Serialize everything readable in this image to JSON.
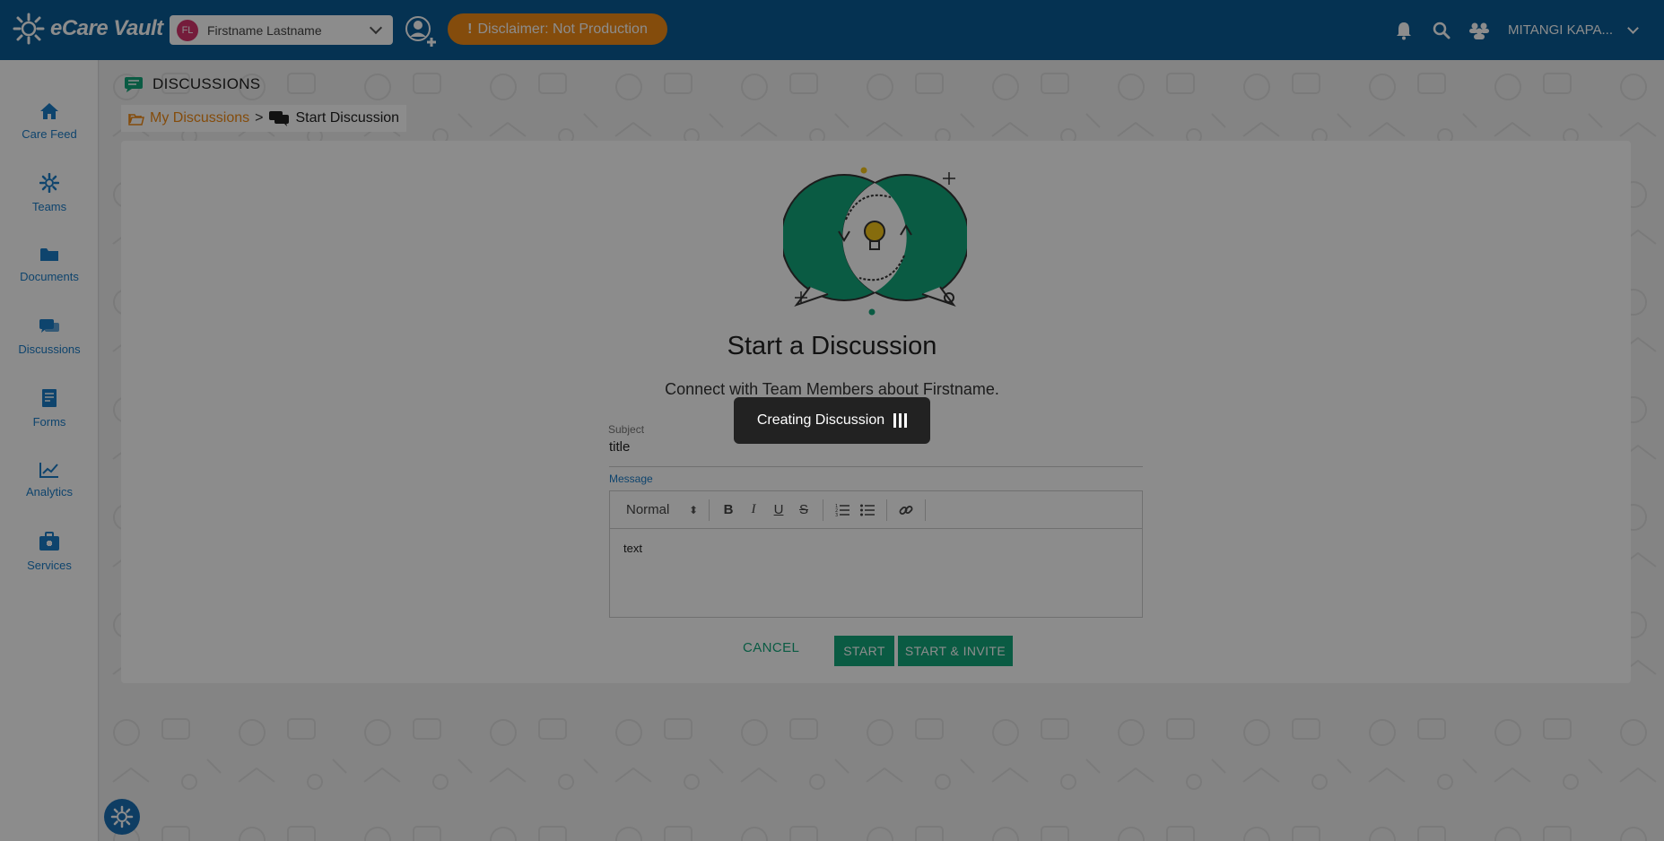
{
  "app": {
    "name": "eCare Vault"
  },
  "header": {
    "patient": {
      "initials": "FL",
      "name": "Firstname Lastname"
    },
    "disclaimer": "Disclaimer: Not Production",
    "user_name": "MITANGI KAPA..."
  },
  "sidebar": {
    "items": [
      {
        "label": "Care Feed",
        "icon": "home-icon"
      },
      {
        "label": "Teams",
        "icon": "teams-icon"
      },
      {
        "label": "Documents",
        "icon": "folder-icon"
      },
      {
        "label": "Discussions",
        "icon": "chat-icon"
      },
      {
        "label": "Forms",
        "icon": "form-icon"
      },
      {
        "label": "Analytics",
        "icon": "chart-icon"
      },
      {
        "label": "Services",
        "icon": "briefcase-icon"
      }
    ]
  },
  "page": {
    "title": "DISCUSSIONS",
    "breadcrumb": {
      "parent": "My Discussions",
      "separator": ">",
      "current": "Start Discussion"
    }
  },
  "form": {
    "heading": "Start a Discussion",
    "subheading": "Connect with Team Members about Firstname.",
    "subject_label": "Subject",
    "subject_value": "title",
    "message_label": "Message",
    "format_value": "Normal",
    "message_value": "text",
    "cancel_label": "CANCEL",
    "start_label": "START",
    "start_invite_label": "START & INVITE"
  },
  "toast": {
    "text": "Creating Discussion"
  },
  "colors": {
    "header": "#0a5c96",
    "accent": "#13a67b",
    "warning": "#f08a16",
    "link": "#1b7cc7"
  }
}
